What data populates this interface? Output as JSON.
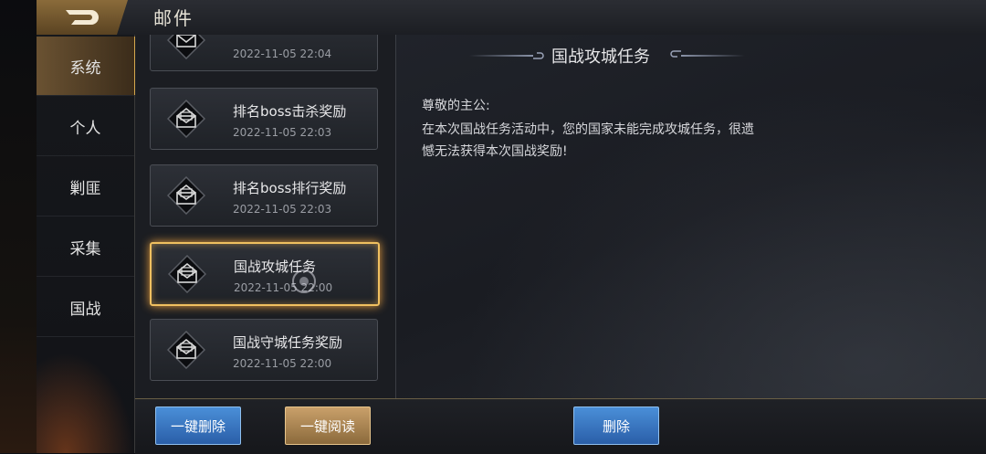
{
  "header": {
    "title": "邮件",
    "back_icon": "back-arrow-icon"
  },
  "sidebar": {
    "items": [
      {
        "label": "系统",
        "active": true
      },
      {
        "label": "个人",
        "active": false
      },
      {
        "label": "剿匪",
        "active": false
      },
      {
        "label": "采集",
        "active": false
      },
      {
        "label": "国战",
        "active": false
      }
    ]
  },
  "mail_list": [
    {
      "title": "",
      "date": "2022-11-05   22:04"
    },
    {
      "title": "排名boss击杀奖励",
      "date": "2022-11-05   22:03"
    },
    {
      "title": "排名boss排行奖励",
      "date": "2022-11-05   22:03"
    },
    {
      "title": "国战攻城任务",
      "date": "2022-11-05   22:00",
      "selected": true
    },
    {
      "title": "国战守城任务奖励",
      "date": "2022-11-05   22:00"
    }
  ],
  "content": {
    "title": "国战攻城任务",
    "greeting": "尊敬的主公:",
    "line1": "在本次国战任务活动中，您的国家未能完成攻城任务，很遗",
    "line2": "憾无法获得本次国战奖励!"
  },
  "buttons": {
    "delete_all": "一键删除",
    "read_all": "一键阅读",
    "delete": "删除"
  },
  "colors": {
    "accent_gold": "#f0c060",
    "button_blue": "#2a5ea8"
  }
}
